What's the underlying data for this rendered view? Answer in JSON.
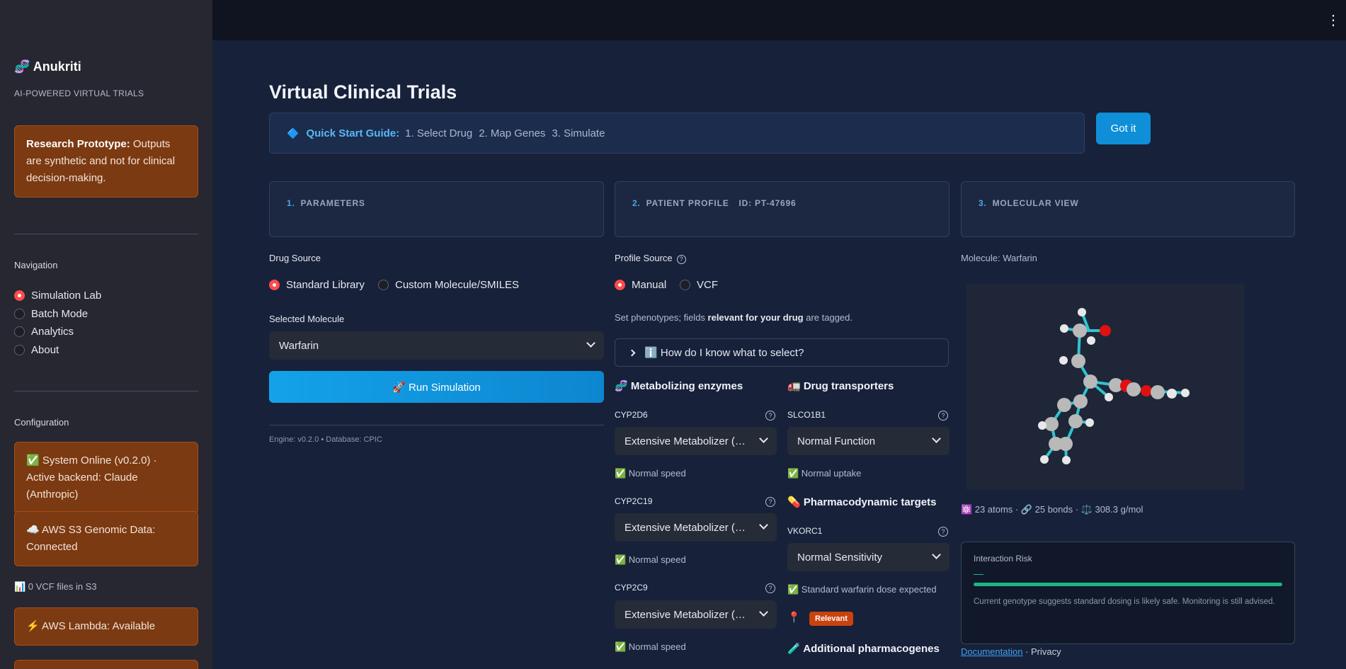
{
  "sidebar": {
    "brand": "🧬 Anukriti",
    "subtitle": "AI-POWERED VIRTUAL TRIALS",
    "notice_bold": "Research Prototype:",
    "notice_text": " Outputs are synthetic and not for clinical decision-making.",
    "nav_title": "Navigation",
    "nav_items": [
      {
        "label": "Simulation Lab",
        "selected": true
      },
      {
        "label": "Batch Mode",
        "selected": false
      },
      {
        "label": "Analytics",
        "selected": false
      },
      {
        "label": "About",
        "selected": false
      }
    ],
    "config_title": "Configuration",
    "status_system": "✅ System Online (v0.2.0) · Active backend: Claude (Anthropic)",
    "status_s3": "☁️ AWS S3 Genomic Data: Connected",
    "vcf_count": "📊 0 VCF files in S3",
    "status_lambda": "⚡ AWS Lambda: Available"
  },
  "main": {
    "title": "Virtual Clinical Trials",
    "guide": {
      "icon": "🔷",
      "label": "Quick Start Guide:",
      "steps": [
        "1. Select Drug",
        "2. Map Genes",
        "3. Simulate"
      ]
    },
    "got_it": "Got it",
    "sections": [
      {
        "num": "1.",
        "title": "PARAMETERS"
      },
      {
        "num": "2.",
        "title": "PATIENT PROFILE",
        "extra": "ID: PT-47696"
      },
      {
        "num": "3.",
        "title": "MOLECULAR VIEW"
      }
    ],
    "params": {
      "drug_source_label": "Drug Source",
      "drug_source_options": [
        "Standard Library",
        "Custom Molecule/SMILES"
      ],
      "selected_label": "Selected Molecule",
      "selected_value": "Warfarin",
      "run_label": "🚀 Run Simulation",
      "engine_info": "Engine: v0.2.0 • Database: CPIC"
    },
    "profile": {
      "source_label": "Profile Source",
      "source_options": [
        "Manual",
        "VCF"
      ],
      "help_pre": "Set phenotypes; fields ",
      "help_bold": "relevant for your drug",
      "help_post": " are tagged.",
      "expander": "ℹ️ How do I know what to select?",
      "enzymes_title": "🧬 Metabolizing enzymes",
      "transporters_title": "🚛 Drug transporters",
      "targets_title": "💊 Pharmacodynamic targets",
      "additional_title": "🧪 Additional pharmacogenes",
      "enzymes": [
        {
          "gene": "CYP2D6",
          "value": "Extensive Metabolizer (…",
          "status": "✅ Normal speed"
        },
        {
          "gene": "CYP2C19",
          "value": "Extensive Metabolizer (…",
          "status": "✅ Normal speed"
        },
        {
          "gene": "CYP2C9",
          "value": "Extensive Metabolizer (…",
          "status": "✅ Normal speed"
        }
      ],
      "transporter": {
        "gene": "SLCO1B1",
        "value": "Normal Function",
        "status": "✅ Normal uptake"
      },
      "target": {
        "gene": "VKORC1",
        "value": "Normal Sensitivity",
        "status": "✅ Standard warfarin dose expected"
      },
      "pin_icon": "📍",
      "relevant_badge": "Relevant"
    },
    "molecular": {
      "label": "Molecule: Warfarin",
      "stats": "⚛️ 23 atoms · 🔗 25 bonds · ⚖️ 308.3 g/mol",
      "risk_title": "Interaction Risk",
      "risk_value": "—",
      "risk_level": 1.0,
      "risk_note": "Current genotype suggests standard dosing is likely safe. Monitoring is still advised.",
      "doc_link": "Documentation",
      "privacy": " · Privacy"
    }
  },
  "colors": {
    "accent": "#0f8fd8",
    "warning_card": "#7c3a12",
    "radio_selected": "#ff4b4b",
    "risk_fill": "#1fb67e",
    "badge": "#c9430f"
  }
}
